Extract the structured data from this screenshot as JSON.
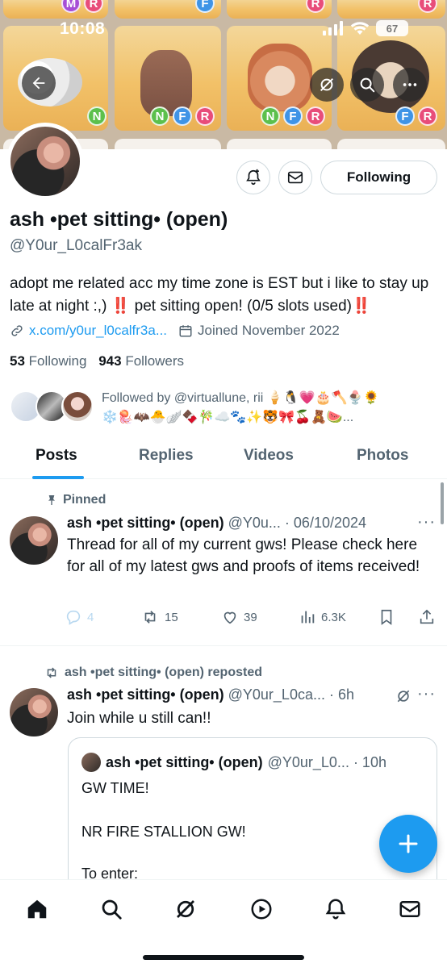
{
  "status_bar": {
    "time": "10:08",
    "battery": "67"
  },
  "banner": {
    "top_row_badges": [
      [
        "M",
        "R"
      ],
      [
        "F"
      ],
      [
        "R"
      ],
      [
        "R"
      ]
    ],
    "tiles": [
      {
        "badges": [
          "N"
        ]
      },
      {
        "badges": [
          "N",
          "F",
          "R"
        ]
      },
      {
        "badges": [
          "N",
          "F",
          "R"
        ]
      },
      {
        "badges": [
          "F",
          "R"
        ]
      }
    ]
  },
  "profile": {
    "display_name": "ash •pet sitting• (open)",
    "handle": "@Y0ur_L0calFr3ak",
    "bio_text": "adopt me related acc my time zone is EST but i like to stay up late at night :,) ",
    "bio_bang": "‼️",
    "bio_text2": " pet sitting open! (0/5 slots used)",
    "link": "x.com/y0ur_l0calfr3a...",
    "joined": "Joined November 2022",
    "following_count": "53",
    "following_label": "Following",
    "followers_count": "943",
    "followers_label": "Followers",
    "followed_by_line1": "Followed by @virtuallune, rii 🍦🐧💗🎂🪓🍨🌻",
    "followed_by_line2": "❄️🪼🦇🐣🪽🍫🎋☁️🐾✨🐯🎀🍒🧸🍉...",
    "following_button": "Following"
  },
  "tabs": [
    "Posts",
    "Replies",
    "Videos",
    "Photos"
  ],
  "posts": [
    {
      "context": "Pinned",
      "name": "ash •pet sitting• (open)",
      "handle_date": "@Y0u... · 06/10/2024",
      "text": "Thread for all of my current gws! Please check here for all of my latest gws and proofs of items received!",
      "replies": "4",
      "reposts": "15",
      "likes": "39",
      "views": "6.3K"
    },
    {
      "context": "ash •pet sitting• (open) reposted",
      "name": "ash •pet sitting• (open)",
      "handle_date": "@Y0ur_L0ca... · 6h",
      "text": "Join while u still can!!",
      "quote": {
        "name": "ash •pet sitting• (open)",
        "handle_date": "@Y0ur_L0... · 10h",
        "line1": "GW TIME!",
        "line2": "NR FIRE STALLION GW!",
        "line3": "To enter:"
      }
    }
  ],
  "colors": {
    "accent": "#1d9bf0",
    "text": "#0f1419",
    "secondary": "#536471",
    "alert": "#e0245e"
  }
}
